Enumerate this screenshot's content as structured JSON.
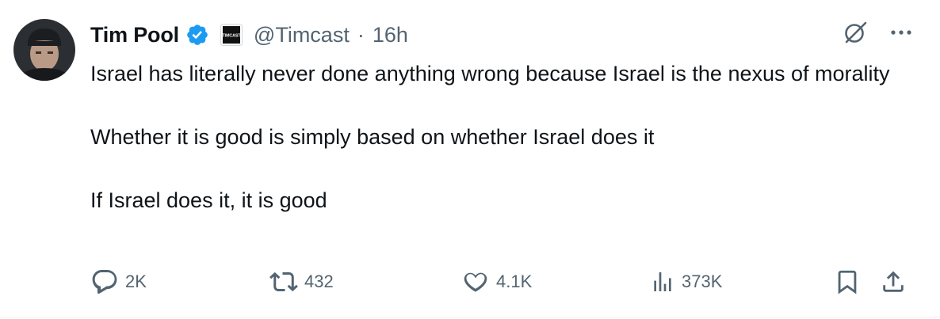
{
  "tweet": {
    "author": {
      "name": "Tim Pool",
      "handle": "@Timcast",
      "verified": true,
      "org_badge": "TIMCAST",
      "avatar_icon": "profile-photo"
    },
    "separator": "·",
    "time": "16h",
    "paragraphs": [
      "Israel has literally never done anything wrong because Israel is the nexus of morality",
      "Whether it is good is simply based on whether Israel does it",
      "If Israel does it, it is good"
    ],
    "metrics": {
      "replies": "2K",
      "reposts": "432",
      "likes": "4.1K",
      "views": "373K"
    },
    "icons": {
      "grok": "grok-icon",
      "more": "more-icon",
      "reply": "reply-icon",
      "repost": "repost-icon",
      "like": "heart-icon",
      "views": "views-icon",
      "bookmark": "bookmark-icon",
      "share": "share-icon"
    },
    "colors": {
      "text": "#0f1419",
      "secondary": "#536471",
      "verified": "#1d9bf0"
    }
  }
}
